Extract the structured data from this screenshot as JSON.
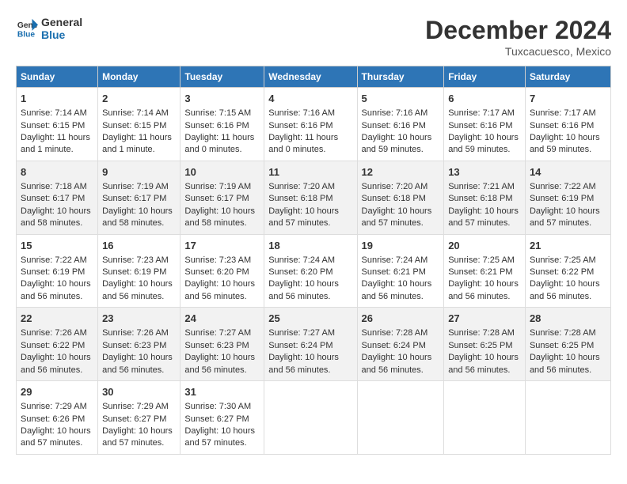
{
  "header": {
    "logo_line1": "General",
    "logo_line2": "Blue",
    "title": "December 2024",
    "subtitle": "Tuxcacuesco, Mexico"
  },
  "days_of_week": [
    "Sunday",
    "Monday",
    "Tuesday",
    "Wednesday",
    "Thursday",
    "Friday",
    "Saturday"
  ],
  "weeks": [
    [
      {
        "day": "1",
        "info": "Sunrise: 7:14 AM\nSunset: 6:15 PM\nDaylight: 11 hours and 1 minute."
      },
      {
        "day": "2",
        "info": "Sunrise: 7:14 AM\nSunset: 6:15 PM\nDaylight: 11 hours and 1 minute."
      },
      {
        "day": "3",
        "info": "Sunrise: 7:15 AM\nSunset: 6:16 PM\nDaylight: 11 hours and 0 minutes."
      },
      {
        "day": "4",
        "info": "Sunrise: 7:16 AM\nSunset: 6:16 PM\nDaylight: 11 hours and 0 minutes."
      },
      {
        "day": "5",
        "info": "Sunrise: 7:16 AM\nSunset: 6:16 PM\nDaylight: 10 hours and 59 minutes."
      },
      {
        "day": "6",
        "info": "Sunrise: 7:17 AM\nSunset: 6:16 PM\nDaylight: 10 hours and 59 minutes."
      },
      {
        "day": "7",
        "info": "Sunrise: 7:17 AM\nSunset: 6:16 PM\nDaylight: 10 hours and 59 minutes."
      }
    ],
    [
      {
        "day": "8",
        "info": "Sunrise: 7:18 AM\nSunset: 6:17 PM\nDaylight: 10 hours and 58 minutes."
      },
      {
        "day": "9",
        "info": "Sunrise: 7:19 AM\nSunset: 6:17 PM\nDaylight: 10 hours and 58 minutes."
      },
      {
        "day": "10",
        "info": "Sunrise: 7:19 AM\nSunset: 6:17 PM\nDaylight: 10 hours and 58 minutes."
      },
      {
        "day": "11",
        "info": "Sunrise: 7:20 AM\nSunset: 6:18 PM\nDaylight: 10 hours and 57 minutes."
      },
      {
        "day": "12",
        "info": "Sunrise: 7:20 AM\nSunset: 6:18 PM\nDaylight: 10 hours and 57 minutes."
      },
      {
        "day": "13",
        "info": "Sunrise: 7:21 AM\nSunset: 6:18 PM\nDaylight: 10 hours and 57 minutes."
      },
      {
        "day": "14",
        "info": "Sunrise: 7:22 AM\nSunset: 6:19 PM\nDaylight: 10 hours and 57 minutes."
      }
    ],
    [
      {
        "day": "15",
        "info": "Sunrise: 7:22 AM\nSunset: 6:19 PM\nDaylight: 10 hours and 56 minutes."
      },
      {
        "day": "16",
        "info": "Sunrise: 7:23 AM\nSunset: 6:19 PM\nDaylight: 10 hours and 56 minutes."
      },
      {
        "day": "17",
        "info": "Sunrise: 7:23 AM\nSunset: 6:20 PM\nDaylight: 10 hours and 56 minutes."
      },
      {
        "day": "18",
        "info": "Sunrise: 7:24 AM\nSunset: 6:20 PM\nDaylight: 10 hours and 56 minutes."
      },
      {
        "day": "19",
        "info": "Sunrise: 7:24 AM\nSunset: 6:21 PM\nDaylight: 10 hours and 56 minutes."
      },
      {
        "day": "20",
        "info": "Sunrise: 7:25 AM\nSunset: 6:21 PM\nDaylight: 10 hours and 56 minutes."
      },
      {
        "day": "21",
        "info": "Sunrise: 7:25 AM\nSunset: 6:22 PM\nDaylight: 10 hours and 56 minutes."
      }
    ],
    [
      {
        "day": "22",
        "info": "Sunrise: 7:26 AM\nSunset: 6:22 PM\nDaylight: 10 hours and 56 minutes."
      },
      {
        "day": "23",
        "info": "Sunrise: 7:26 AM\nSunset: 6:23 PM\nDaylight: 10 hours and 56 minutes."
      },
      {
        "day": "24",
        "info": "Sunrise: 7:27 AM\nSunset: 6:23 PM\nDaylight: 10 hours and 56 minutes."
      },
      {
        "day": "25",
        "info": "Sunrise: 7:27 AM\nSunset: 6:24 PM\nDaylight: 10 hours and 56 minutes."
      },
      {
        "day": "26",
        "info": "Sunrise: 7:28 AM\nSunset: 6:24 PM\nDaylight: 10 hours and 56 minutes."
      },
      {
        "day": "27",
        "info": "Sunrise: 7:28 AM\nSunset: 6:25 PM\nDaylight: 10 hours and 56 minutes."
      },
      {
        "day": "28",
        "info": "Sunrise: 7:28 AM\nSunset: 6:25 PM\nDaylight: 10 hours and 56 minutes."
      }
    ],
    [
      {
        "day": "29",
        "info": "Sunrise: 7:29 AM\nSunset: 6:26 PM\nDaylight: 10 hours and 57 minutes."
      },
      {
        "day": "30",
        "info": "Sunrise: 7:29 AM\nSunset: 6:27 PM\nDaylight: 10 hours and 57 minutes."
      },
      {
        "day": "31",
        "info": "Sunrise: 7:30 AM\nSunset: 6:27 PM\nDaylight: 10 hours and 57 minutes."
      },
      {
        "day": "",
        "info": ""
      },
      {
        "day": "",
        "info": ""
      },
      {
        "day": "",
        "info": ""
      },
      {
        "day": "",
        "info": ""
      }
    ]
  ]
}
